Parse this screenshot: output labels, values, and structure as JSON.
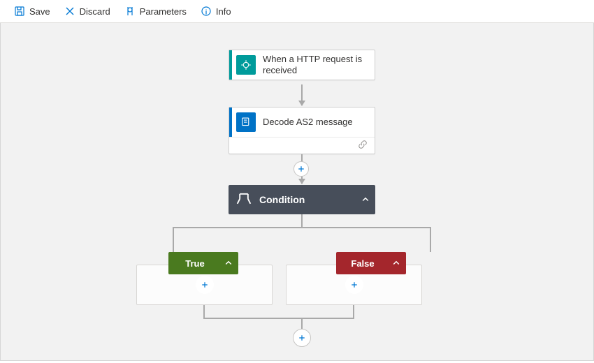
{
  "toolbar": {
    "save": "Save",
    "discard": "Discard",
    "parameters": "Parameters",
    "info": "Info"
  },
  "node1": {
    "title": "When a HTTP request is received"
  },
  "node2": {
    "title": "Decode AS2 message"
  },
  "condition": {
    "title": "Condition"
  },
  "branches": {
    "true": "True",
    "false": "False"
  }
}
